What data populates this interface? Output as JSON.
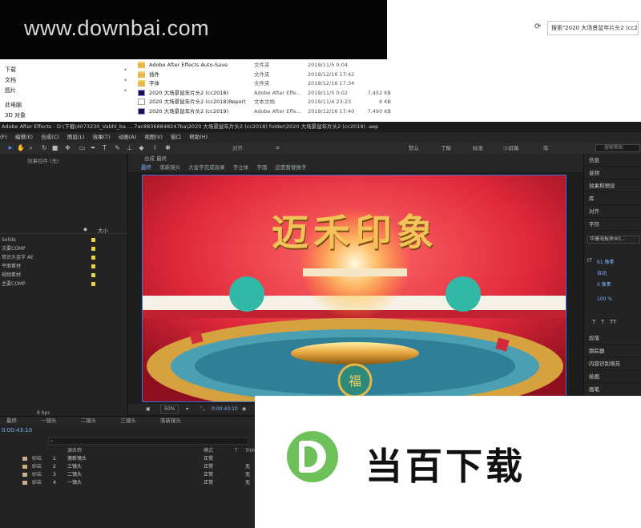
{
  "explorer": {
    "search_text": "搜索\"2020 大场景鼠年片头2 (cc2...",
    "nav": [
      {
        "label": "下载",
        "pinned": true
      },
      {
        "label": "文档",
        "pinned": true
      },
      {
        "label": "图片",
        "pinned": true
      },
      {
        "label": "此电脑",
        "pinned": false
      },
      {
        "label": "3D 对象",
        "pinned": false
      }
    ],
    "files": [
      {
        "name": "Adobe After Effects Auto-Save",
        "type": "文件夹",
        "date": "2019/11/5 0:04",
        "size": "",
        "icon": "folder"
      },
      {
        "name": "插件",
        "type": "文件夹",
        "date": "2019/12/16 17:42",
        "size": "",
        "icon": "folder"
      },
      {
        "name": "字体",
        "type": "文件夹",
        "date": "2019/12/16 17:34",
        "size": "",
        "icon": "folder"
      },
      {
        "name": "2020 大场景鼠年片头2 (cc2018)",
        "type": "Adobe After Effe...",
        "date": "2019/11/5 0:02",
        "size": "7,452 KB",
        "icon": "ae"
      },
      {
        "name": "2020 大场景鼠年片头2 (cc2018)Report",
        "type": "文本文档",
        "date": "2019/11/4 23:23",
        "size": "6 KB",
        "icon": "txt"
      },
      {
        "name": "2020 大场景鼠年片头2 (cc2019)",
        "type": "Adobe After Effe...",
        "date": "2019/12/16 17:40",
        "size": "7,490 KB",
        "icon": "ae"
      }
    ]
  },
  "watermark_top": "www.downbai.com",
  "ae": {
    "title": "Adobe After Effects - D:\\下载\\4073230_Vabhl_ba ... 7ac88368848247ba\\2020 大场景鼠年片头2 (cc2018) folder\\2020 大场景鼠年片头2 (cc2019) .aep",
    "menu": [
      "(F)",
      "编辑(E)",
      "合成(C)",
      "图层(L)",
      "效果(T)",
      "动画(A)",
      "视图(V)",
      "窗口",
      "帮助(H)"
    ],
    "toolbar": {
      "align_label": "对齐",
      "workspaces": [
        "默认",
        "了解",
        "标准",
        "小屏幕",
        "库"
      ],
      "search_placeholder": "搜索帮助"
    },
    "left_panel": {
      "effect_controls_label": "效果控件 (无)",
      "column_size": "大小",
      "items": [
        "Solids",
        "次要COMP",
        "常识大金字 AE",
        "平面素材",
        "视频素材",
        "主要COMP"
      ],
      "bpc": "8 bpc"
    },
    "comp_panel": {
      "tab_label": "合成 最终",
      "crumbs": [
        "最终",
        "落新镜头",
        "大金字完成效果",
        "字立体",
        "字面",
        "近度暂替换字"
      ],
      "zoom": "50%",
      "timecode": "0:00:43:10"
    },
    "viewer": {
      "title_art": "迈禾印象"
    },
    "right_panel": {
      "items": [
        "信息",
        "音频",
        "效果和预设",
        "库",
        "对齐",
        "字符"
      ],
      "font": "华康海报体W1...",
      "size_text": "61 像素",
      "leading_text": "自动",
      "tracking_text": "0 像素",
      "scale_text": "100 %",
      "lower_items": [
        "段落",
        "跟踪器",
        "内容识别填充",
        "绘画",
        "画笔"
      ]
    },
    "timeline": {
      "tabs": [
        "最终",
        "一镜头",
        "二镜头",
        "三镜头",
        "落新镜头"
      ],
      "timecode": "0:00:43:10",
      "col_source": "源名称",
      "col_mode": "模式",
      "col_t": "T",
      "col_trkmat": "TrkMat",
      "layers": [
        {
          "num": "1",
          "name": "落新镜头",
          "mode": "正常",
          "trkmat": ""
        },
        {
          "num": "2",
          "name": "三镜头",
          "mode": "正常",
          "trkmat": "无"
        },
        {
          "num": "3",
          "name": "二镜头",
          "mode": "正常",
          "trkmat": "无"
        },
        {
          "num": "4",
          "name": "一镜头",
          "mode": "正常",
          "trkmat": "无"
        }
      ],
      "layer_color": "砂岩"
    }
  },
  "watermark_bottom": {
    "logo_letter": "D",
    "text": "当百下载",
    "logo_color": "#6ec15a"
  }
}
